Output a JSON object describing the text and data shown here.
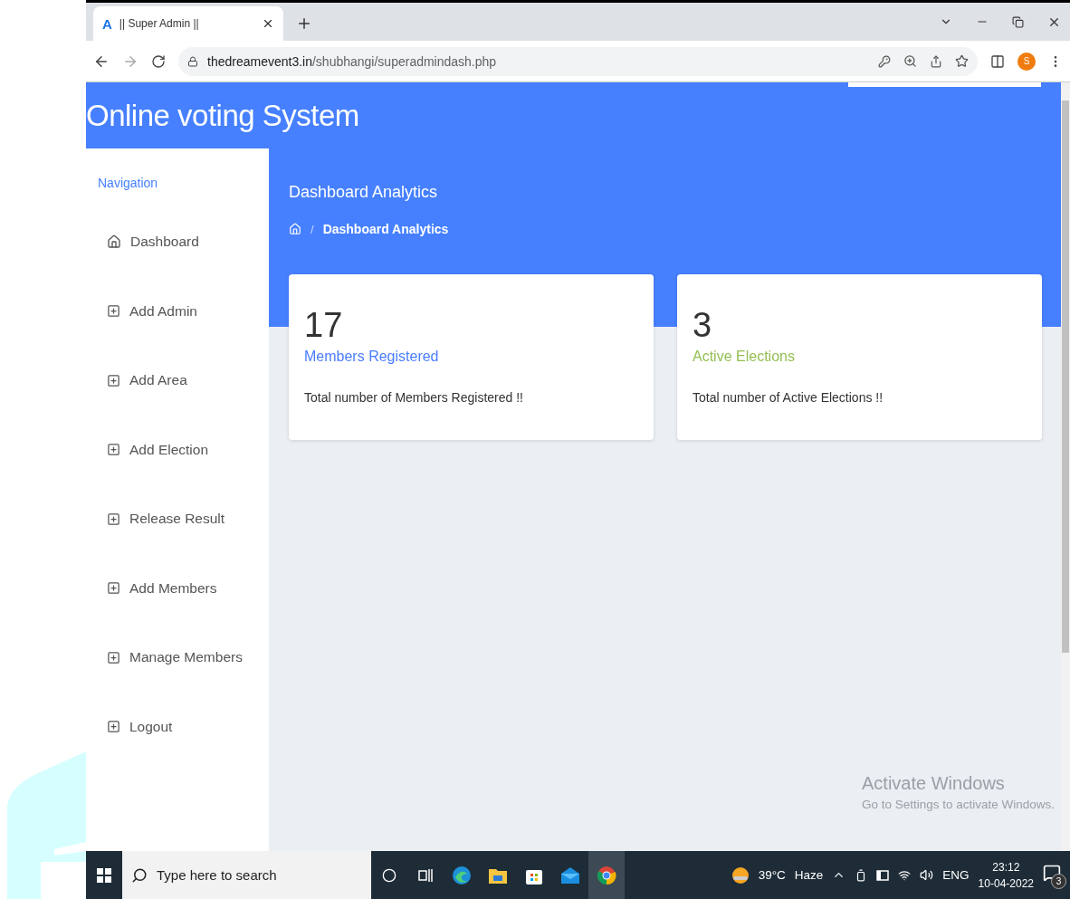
{
  "browser": {
    "tab": {
      "favicon": "A",
      "title": "|| Super Admin ||"
    },
    "url_host": "thedreamevent3.in",
    "url_path": "/shubhangi/superadmindash.php",
    "profile_initial": "S"
  },
  "app_title": "Online voting System",
  "sidebar": {
    "heading": "Navigation",
    "items": [
      {
        "label": "Dashboard",
        "kind": "home"
      },
      {
        "label": "Add Admin",
        "kind": "add"
      },
      {
        "label": "Add Area",
        "kind": "add"
      },
      {
        "label": "Add Election",
        "kind": "add"
      },
      {
        "label": "Release Result",
        "kind": "add"
      },
      {
        "label": "Add Members",
        "kind": "add"
      },
      {
        "label": "Manage Members",
        "kind": "add"
      },
      {
        "label": "Logout",
        "kind": "add"
      }
    ]
  },
  "page_heading": "Dashboard Analytics",
  "breadcrumb_separator": "/",
  "breadcrumb": "Dashboard Analytics",
  "cards": [
    {
      "value": "17",
      "label": "Members Registered",
      "color": "#4a7dff",
      "description": "Total number of Members Registered !!"
    },
    {
      "value": "3",
      "label": "Active Elections",
      "color": "#93be52",
      "description": "Total number of Active Elections !!"
    }
  ],
  "activation": {
    "title": "Activate Windows",
    "subtitle": "Go to Settings to activate Windows."
  },
  "taskbar": {
    "search_placeholder": "Type here to search",
    "temperature": "39°C",
    "weather": "Haze",
    "language": "ENG",
    "time": "23:12",
    "date": "10-04-2022",
    "notifications": "3"
  }
}
